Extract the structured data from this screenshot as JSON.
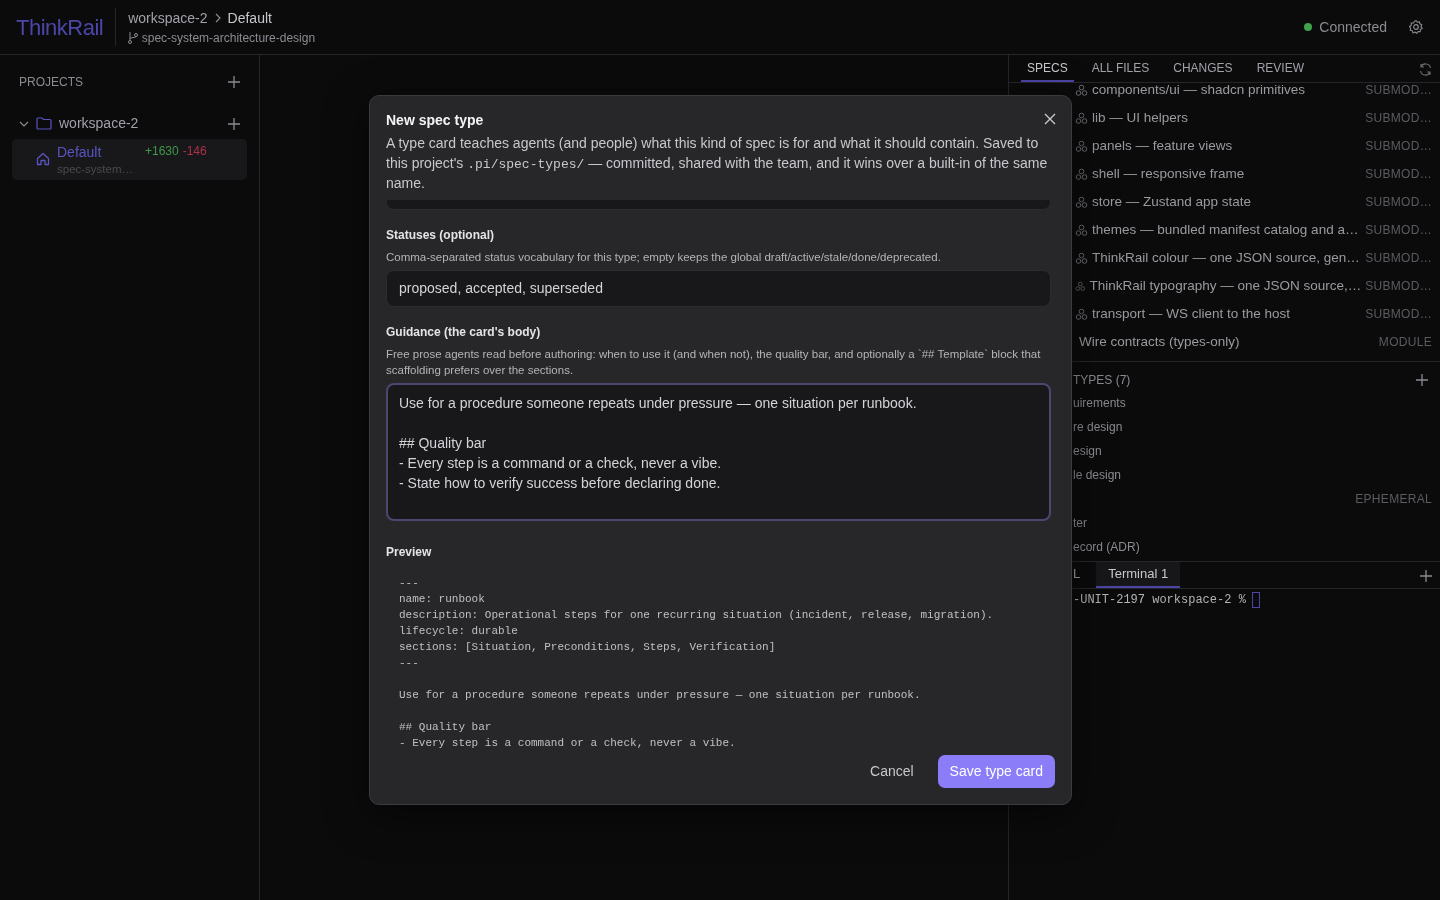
{
  "header": {
    "logo": "ThinkRail",
    "breadcrumb": [
      "workspace-2",
      "Default"
    ],
    "branch": "spec-system-architecture-design",
    "connection": {
      "label": "Connected",
      "color": "#3fa34d"
    }
  },
  "sidebar": {
    "title": "PROJECTS",
    "projects": [
      {
        "name": "workspace-2",
        "expanded": true,
        "children": [
          {
            "name": "Default",
            "added": "+1630",
            "removed": "-146",
            "branch": "spec-system…",
            "selected": true
          }
        ]
      }
    ]
  },
  "right_panel": {
    "tabs": [
      {
        "label": "SPECS",
        "selected": true
      },
      {
        "label": "ALL FILES",
        "selected": false
      },
      {
        "label": "CHANGES",
        "selected": false
      },
      {
        "label": "REVIEW",
        "selected": false
      }
    ],
    "specs": [
      {
        "title": "components/ui — shadcn primitives",
        "tag": "SUBMOD…",
        "kind": "submodule"
      },
      {
        "title": "lib — UI helpers",
        "tag": "SUBMOD…",
        "kind": "submodule"
      },
      {
        "title": "panels — feature views",
        "tag": "SUBMOD…",
        "kind": "submodule"
      },
      {
        "title": "shell — responsive frame",
        "tag": "SUBMOD…",
        "kind": "submodule"
      },
      {
        "title": "store — Zustand app state",
        "tag": "SUBMOD…",
        "kind": "submodule"
      },
      {
        "title": "themes — bundled manifest catalog and a…",
        "tag": "SUBMOD…",
        "kind": "submodule"
      },
      {
        "title": "ThinkRail colour — one JSON source, gen…",
        "tag": "SUBMOD…",
        "kind": "submodule"
      },
      {
        "title": "ThinkRail typography — one JSON source,…",
        "tag": "SUBMOD…",
        "kind": "submodule"
      },
      {
        "title": "transport — WS client to the host",
        "tag": "SUBMOD…",
        "kind": "submodule"
      },
      {
        "title": "Wire contracts (types-only)",
        "tag": "MODULE",
        "kind": "module"
      }
    ],
    "types": {
      "title": "TYPES (7)",
      "items": [
        {
          "text": "uirements"
        },
        {
          "text": "re design"
        },
        {
          "text": "esign"
        },
        {
          "text": "le design"
        },
        {
          "tag": "EPHEMERAL"
        },
        {
          "text": "ter"
        },
        {
          "text": "ecord (ADR)"
        }
      ]
    },
    "terminal": {
      "tabs": [
        {
          "label": "L",
          "selected": false
        },
        {
          "label": "Terminal 1",
          "selected": true
        }
      ],
      "line": "-UNIT-2197 workspace-2 %"
    }
  },
  "modal": {
    "title": "New spec type",
    "description": [
      {
        "kind": "text",
        "text": "A type card teaches agents (and people) what this kind of spec is for and what it should contain. Saved to this project's "
      },
      {
        "kind": "code",
        "text": ".pi/spec-types/"
      },
      {
        "kind": "text",
        "text": " — committed, shared with the team, and it wins over a built-in of the same name."
      }
    ],
    "fields": [
      {
        "kind": "input",
        "label": "Statuses (optional)",
        "help": "Comma-separated status vocabulary for this type; empty keeps the global draft/active/stale/done/deprecated.",
        "value": "proposed, accepted, superseded",
        "focused": false
      },
      {
        "kind": "textarea",
        "label": "Guidance (the card's body)",
        "help": "Free prose agents read before authoring: when to use it (and when not), the quality bar, and optionally a `## Template` block that scaffolding prefers over the sections.",
        "value": "Use for a procedure someone repeats under pressure — one situation per runbook.\n\n## Quality bar\n- Every step is a command or a check, never a vibe.\n- State how to verify success before declaring done.",
        "focused": true
      }
    ],
    "preview": {
      "label": "Preview",
      "text": "---\nname: runbook\ndescription: Operational steps for one recurring situation (incident, release, migration).\nlifecycle: durable\nsections: [Situation, Preconditions, Steps, Verification]\n---\n\nUse for a procedure someone repeats under pressure — one situation per runbook.\n\n## Quality bar\n- Every step is a command or a check, never a vibe."
    },
    "buttons": [
      {
        "label": "Cancel",
        "kind": "secondary"
      },
      {
        "label": "Save type card",
        "kind": "primary"
      }
    ]
  }
}
